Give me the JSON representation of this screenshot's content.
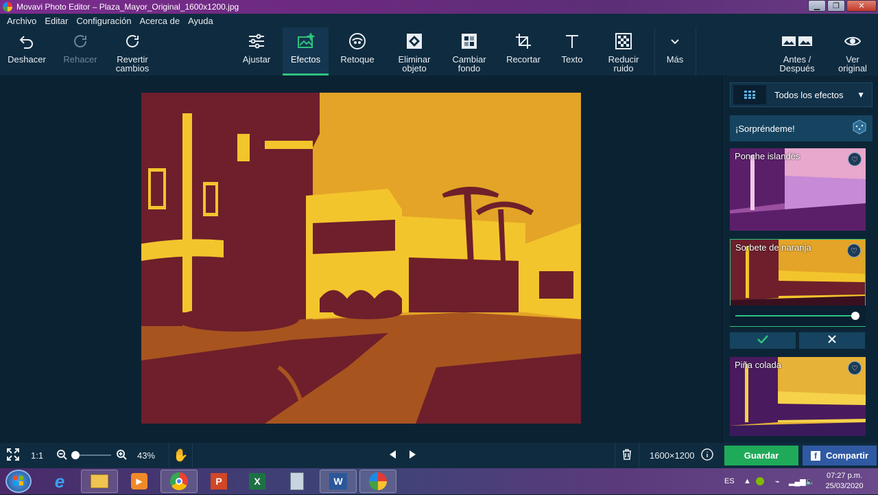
{
  "window": {
    "title": "Movavi Photo Editor – Plaza_Mayor_Original_1600x1200.jpg",
    "controls": [
      "minimize",
      "maximize",
      "close"
    ]
  },
  "menu": [
    "Archivo",
    "Editar",
    "Configuración",
    "Acerca de",
    "Ayuda"
  ],
  "toolbar": {
    "undo": "Deshacer",
    "redo": "Rehacer",
    "revert_line1": "Revertir",
    "revert_line2": "cambios",
    "adjust": "Ajustar",
    "effects": "Efectos",
    "retouch": "Retoque",
    "remove_line1": "Eliminar",
    "remove_line2": "objeto",
    "bg_line1": "Cambiar",
    "bg_line2": "fondo",
    "crop": "Recortar",
    "text": "Texto",
    "noise_line1": "Reducir",
    "noise_line2": "ruido",
    "more": "Más",
    "before_line1": "Antes /",
    "before_line2": "Después",
    "view_line1": "Ver",
    "view_line2": "original"
  },
  "panel": {
    "dropdown_label": "Todos los efectos",
    "surprise_label": "¡Sorpréndeme!",
    "effects": [
      {
        "name": "Ponche islandés"
      },
      {
        "name": "Sorbete de naranja",
        "selected": true,
        "intensity": 1.0
      },
      {
        "name": "Piña colada"
      }
    ],
    "apply_icon": "check-icon",
    "cancel_icon": "close-icon"
  },
  "bottom": {
    "zoom_ratio": "1:1",
    "zoom_level_value": 0.0,
    "zoom": "43%",
    "dimensions": "1600×1200",
    "save": "Guardar",
    "share": "Compartir"
  },
  "taskbar": {
    "language": "ES",
    "time": "07:27 p.m.",
    "date": "25/03/2020"
  },
  "colors": {
    "accent_green": "#2ec27e",
    "save_green": "#1faa59",
    "share_blue": "#2f5aa3",
    "panel_bg": "#0f2b3f"
  }
}
